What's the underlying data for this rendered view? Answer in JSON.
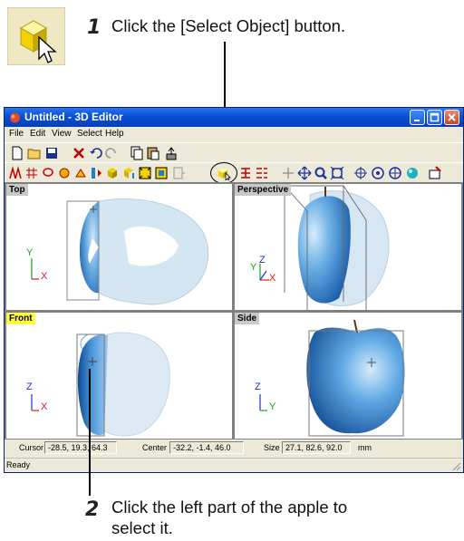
{
  "steps": [
    {
      "number": "1",
      "text": "Click the [Select Object] button."
    },
    {
      "number": "2",
      "text_line1": "Click the left part of the apple to",
      "text_line2": "select it."
    }
  ],
  "window": {
    "title": "Untitled - 3D Editor",
    "controls": [
      "minimize",
      "maximize",
      "close"
    ]
  },
  "menu": [
    {
      "label": "File"
    },
    {
      "label": "Edit"
    },
    {
      "label": "View"
    },
    {
      "label": "Select"
    },
    {
      "label": "Help"
    }
  ],
  "toolbar_row1_icons": [
    "new-file-icon",
    "open-folder-icon",
    "save-icon",
    "delete-icon",
    "undo-icon",
    "redo-icon",
    "copy-icon",
    "paste-icon",
    "object-properties-icon"
  ],
  "toolbar_row2_icons": [
    "arc-icon",
    "grid-icon",
    "lasso-icon",
    "sphere-tool-icon",
    "paint-icon",
    "align-icon",
    "box-tool-icon",
    "extrude-icon",
    "group-icon",
    "ungroup-icon",
    "mirror-icon",
    "select-object-icon",
    "select-part-icon",
    "select-all-icon",
    "rotate-icon",
    "move-icon",
    "zoom-icon",
    "fit-icon",
    "pan-icon",
    "center-icon",
    "orbit-icon",
    "render-icon",
    "settings-icon"
  ],
  "viewports": {
    "top": {
      "label": "Top",
      "axis_v": "Y",
      "axis_h": "X"
    },
    "perspective": {
      "label": "Perspective",
      "axis_v": "Y",
      "axis_z": "Z",
      "axis_h": "X"
    },
    "front": {
      "label": "Front",
      "axis_v": "Z",
      "axis_h": "X",
      "active": true
    },
    "side": {
      "label": "Side",
      "axis_v": "Z",
      "axis_h": "Y"
    }
  },
  "status": {
    "cursor_label": "Cursor",
    "cursor_value": "-28.5, 19.3, 64.3",
    "center_label": "Center",
    "center_value": "-32.2, -1.4, 46.0",
    "size_label": "Size",
    "size_value": "27.1, 82.6, 92.0",
    "unit": "mm",
    "ready": "Ready"
  },
  "colors": {
    "title_blue": "#0a4fd6",
    "active_label": "#ffff40",
    "apple_blue": "#2f7fd0",
    "axis_green": "#17a317",
    "axis_red": "#d81a1a",
    "axis_blue": "#1a2fd8"
  }
}
